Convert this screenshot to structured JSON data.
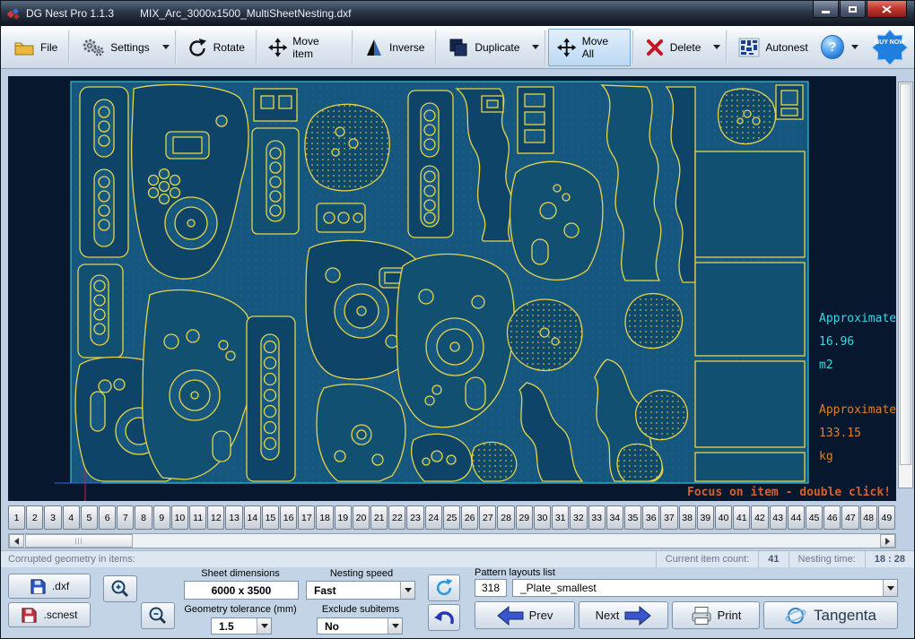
{
  "titlebar": {
    "app_title": "DG Nest Pro 1.1.3",
    "document_title": "MIX_Arc_3000x1500_MultiSheetNesting.dxf"
  },
  "toolbar": {
    "items": [
      {
        "label": "File",
        "icon": "folder-icon"
      },
      {
        "label": "Settings",
        "icon": "gears-icon"
      },
      {
        "label": "Rotate",
        "icon": "rotate-icon"
      },
      {
        "label": "Move item",
        "icon": "move-icon"
      },
      {
        "label": "Inverse",
        "icon": "inverse-icon"
      },
      {
        "label": "Duplicate",
        "icon": "duplicate-icon"
      },
      {
        "label": "Move All",
        "icon": "move-icon"
      },
      {
        "label": "Delete",
        "icon": "delete-icon"
      },
      {
        "label": "Autonest",
        "icon": "autonest-icon"
      }
    ],
    "help": "?",
    "buy_now": "BUY NOW"
  },
  "canvas": {
    "area_label": "Approximate",
    "area_value": "16.96",
    "area_unit": "m2",
    "weight_label": "Approximate",
    "weight_value": "133.15",
    "weight_unit": "kg",
    "hint": "Focus on item - double click!"
  },
  "sheet_tabs": [
    "1",
    "2",
    "3",
    "4",
    "5",
    "6",
    "7",
    "8",
    "9",
    "10",
    "11",
    "12",
    "13",
    "14",
    "15",
    "16",
    "17",
    "18",
    "19",
    "20",
    "21",
    "22",
    "23",
    "24",
    "25",
    "26",
    "27",
    "28",
    "29",
    "30",
    "31",
    "32",
    "33",
    "34",
    "35",
    "36",
    "37",
    "38",
    "39",
    "40",
    "41",
    "42",
    "43",
    "44",
    "45",
    "46",
    "47",
    "48",
    "49"
  ],
  "status": {
    "corrupted_label": "Corrupted geometry in items:",
    "item_count_label": "Current item count:",
    "item_count_value": "41",
    "nesting_time_label": "Nesting time:",
    "nesting_time_value": "18 : 28"
  },
  "controls": {
    "dxf": ".dxf",
    "scnest": ".scnest",
    "sheet_dimensions_label": "Sheet dimensions",
    "sheet_dimensions_value": "6000 x 3500",
    "geometry_tolerance_label": "Geometry tolerance (mm)",
    "geometry_tolerance_value": "1.5",
    "nesting_speed_label": "Nesting speed",
    "nesting_speed_value": "Fast",
    "exclude_subitems_label": "Exclude subitems",
    "exclude_subitems_value": "No",
    "pattern_layouts_label": "Pattern layouts list",
    "pattern_count": "318",
    "pattern_selected": "_Plate_smallest",
    "prev": "Prev",
    "next": "Next",
    "print": "Print",
    "brand": "Tangenta"
  },
  "colors": {
    "sheet": "#15577e",
    "part_stroke": "#e6d44a",
    "area_text": "#38d8e8",
    "weight_text": "#e0802a"
  }
}
